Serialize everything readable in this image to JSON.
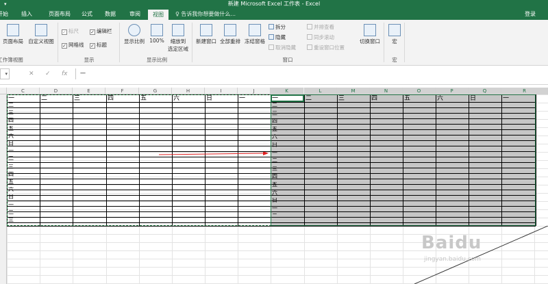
{
  "window": {
    "title": "新建 Microsoft Excel 工作表 - Excel",
    "qa_marker": "▾"
  },
  "tabs": [
    {
      "label": "开始",
      "active": false
    },
    {
      "label": "插入",
      "active": false
    },
    {
      "label": "页面布局",
      "active": false
    },
    {
      "label": "公式",
      "active": false
    },
    {
      "label": "数据",
      "active": false
    },
    {
      "label": "审阅",
      "active": false
    },
    {
      "label": "视图",
      "active": true
    }
  ],
  "tell_me": "告诉我你想要做什么...",
  "login": "登录",
  "ribbon": {
    "workbook_views": {
      "page_layout": "页面布局",
      "custom_views": "自定义视图",
      "label": "工作簿视图"
    },
    "show": {
      "ruler": "标尺",
      "formula_bar": "编辑栏",
      "gridlines": "网格线",
      "headings": "标题",
      "label": "显示"
    },
    "zoom": {
      "zoom": "显示比例",
      "percent": "100%",
      "zoom_to_selection_1": "缩放到",
      "zoom_to_selection_2": "选定区域",
      "label": "显示比例"
    },
    "window": {
      "new_window": "新建窗口",
      "arrange_all": "全部重排",
      "freeze_panes": "冻结窗格",
      "split": "拆分",
      "hide": "隐藏",
      "unhide": "取消隐藏",
      "side_by_side": "并排查看",
      "sync_scroll": "同步滚动",
      "reset_position": "重设窗口位置",
      "switch_windows": "切换窗口",
      "label": "窗口"
    },
    "macros": {
      "macros": "宏",
      "label": "宏"
    }
  },
  "formula_bar": {
    "name_box": "▾",
    "cancel": "✕",
    "enter": "✓",
    "fx": "fx",
    "content": "一"
  },
  "columns": [
    "C",
    "D",
    "E",
    "F",
    "G",
    "H",
    "I",
    "J",
    "K",
    "L",
    "M",
    "N",
    "O",
    "P",
    "Q",
    "R"
  ],
  "selected_columns": [
    "K",
    "L",
    "M",
    "N",
    "O",
    "P",
    "Q",
    "R"
  ],
  "left_table": {
    "header": [
      "一",
      "二",
      "三",
      "四",
      "五",
      "六",
      "日",
      "一"
    ],
    "rows": [
      "二",
      "三",
      "四",
      "五",
      "六",
      "日",
      "一",
      "二",
      "三",
      "四",
      "五",
      "六",
      "日",
      "一",
      "二",
      "三"
    ]
  },
  "right_table": {
    "header": [
      "一",
      "二",
      "三",
      "四",
      "五",
      "六",
      "日",
      "一"
    ],
    "rows": [
      "二",
      "三",
      "四",
      "五",
      "六",
      "日",
      "一",
      "二",
      "三",
      "四",
      "五",
      "六",
      "日",
      "一",
      "二"
    ]
  },
  "watermark": {
    "brand": "Baidu",
    "sub": "jingyan.baidu.com"
  },
  "colors": {
    "excel_green": "#217346",
    "selection_fill": "#c6c6c6",
    "arrow": "#e02020"
  }
}
